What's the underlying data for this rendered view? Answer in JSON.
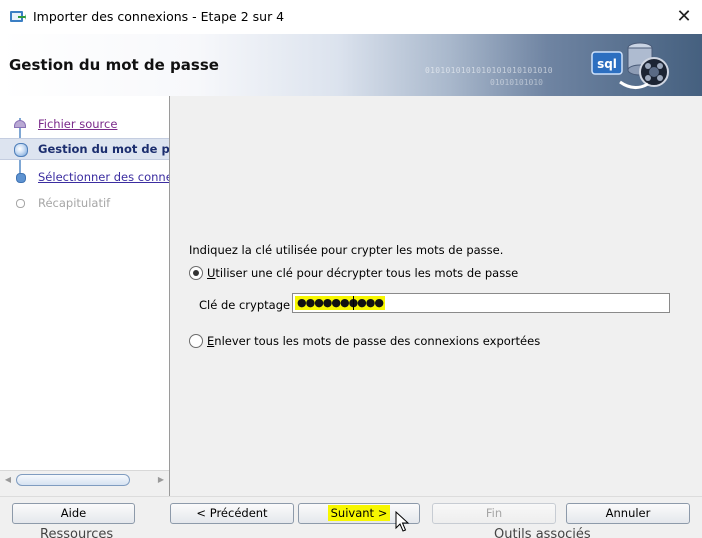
{
  "window": {
    "title": "Importer des connexions - Etape 2 sur 4",
    "close_glyph": "✕",
    "app_icon": "import-connections-icon"
  },
  "header": {
    "title": "Gestion du mot de passe",
    "logo_text": "sql",
    "binary_line1": "0101010101010101010101010",
    "binary_line2": "01010101010"
  },
  "steps": [
    {
      "label": "Fichier source",
      "state": "visited"
    },
    {
      "label": "Gestion du mot de pa",
      "state": "current"
    },
    {
      "label": "Sélectionner des connex",
      "state": "link"
    },
    {
      "label": "Récapitulatif",
      "state": "disabled"
    }
  ],
  "content": {
    "instruction": "Indiquez la clé utilisée pour crypter les mots de passe.",
    "option1": {
      "prefix": "U",
      "rest": "tiliser une clé pour décrypter tous les mots de passe",
      "selected": true
    },
    "key_label": "Clé de cryptage",
    "key_value": "●●●●●●●●●●",
    "option2": {
      "prefix": "E",
      "rest": "nlever tous les mots de passe des connexions exportées",
      "selected": false
    }
  },
  "buttons": {
    "help": "Aide",
    "previous": "< Précédent",
    "next": "Suivant >",
    "finish": "Fin",
    "cancel": "Annuler"
  },
  "background_peek": {
    "left": "Ressources",
    "right": "Outils associés"
  },
  "colors": {
    "highlight": "#f7f700",
    "current_step_bg": "#dde4f0",
    "link": "#3b2da0"
  }
}
